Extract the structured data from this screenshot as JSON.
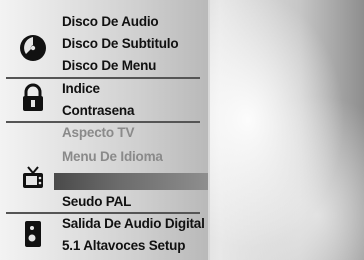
{
  "sections": {
    "audio": {
      "icon": "disc-icon",
      "items": [
        "Disco De Audio",
        "Disco De Subtitulo",
        "Disco De Menu"
      ]
    },
    "parental": {
      "icon": "padlock-icon",
      "items": [
        "Indice",
        "Contrasena"
      ]
    },
    "tv": {
      "icon": "tv-icon",
      "items": [
        "Aspecto TV",
        "Menu De Idioma",
        "Seudo PAL"
      ]
    },
    "speaker": {
      "icon": "speaker-icon",
      "items": [
        "Salida De Audio Digital",
        "5.1 Altavoces Setup"
      ]
    }
  },
  "colors": {
    "text": "#111111",
    "dim_text": "#8a8a8a",
    "highlight": "#5a5a5a"
  }
}
